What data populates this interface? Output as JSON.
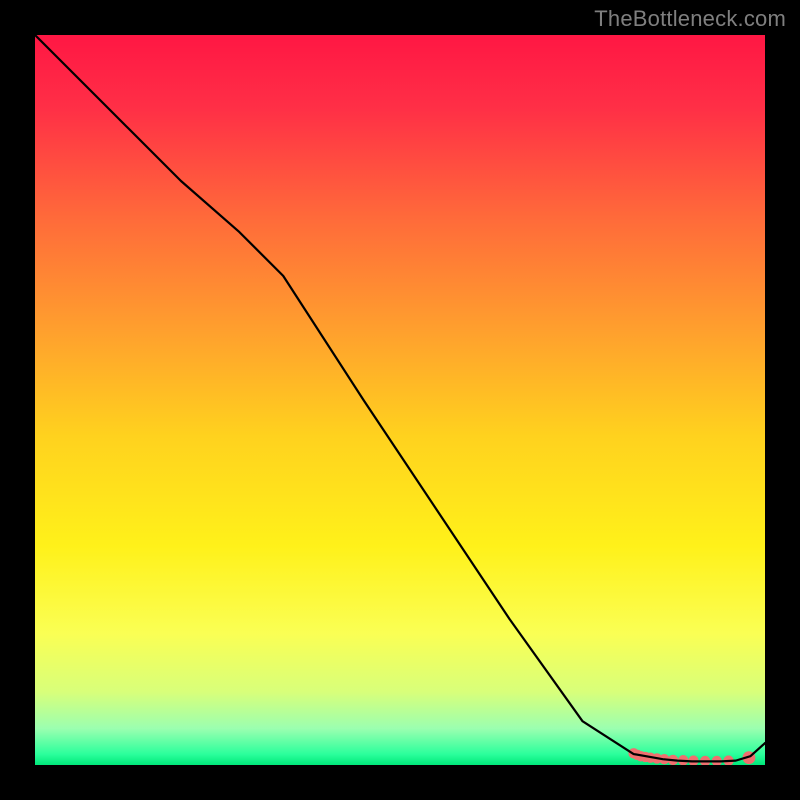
{
  "watermark": "TheBottleneck.com",
  "chart_data": {
    "type": "line",
    "title": "",
    "xlabel": "",
    "ylabel": "",
    "xlim": [
      0,
      100
    ],
    "ylim": [
      0,
      100
    ],
    "axes_visible": false,
    "background_gradient": {
      "stops": [
        {
          "offset": 0.0,
          "color": "#ff1744"
        },
        {
          "offset": 0.1,
          "color": "#ff2f46"
        },
        {
          "offset": 0.25,
          "color": "#ff6a3a"
        },
        {
          "offset": 0.4,
          "color": "#ff9e2e"
        },
        {
          "offset": 0.55,
          "color": "#ffd21e"
        },
        {
          "offset": 0.7,
          "color": "#fff11a"
        },
        {
          "offset": 0.82,
          "color": "#faff54"
        },
        {
          "offset": 0.9,
          "color": "#d8ff7a"
        },
        {
          "offset": 0.95,
          "color": "#9bffb0"
        },
        {
          "offset": 0.985,
          "color": "#2cff9c"
        },
        {
          "offset": 1.0,
          "color": "#00e87a"
        }
      ]
    },
    "series": [
      {
        "name": "bottleneck-curve",
        "stroke": "#000000",
        "stroke_width": 2.2,
        "x": [
          0,
          10,
          20,
          28,
          34,
          45,
          55,
          65,
          75,
          82,
          86,
          88,
          90,
          92,
          94,
          96,
          98,
          100
        ],
        "y": [
          100,
          90,
          80,
          73,
          67,
          50,
          35,
          20,
          6,
          1.5,
          0.8,
          0.6,
          0.5,
          0.5,
          0.5,
          0.6,
          1.2,
          3
        ]
      }
    ],
    "markers": {
      "name": "highlight-band",
      "color": "#ef6f6f",
      "radius_main": 5.2,
      "radius_end": 6.4,
      "points": [
        {
          "x": 82.0,
          "y": 1.6
        },
        {
          "x": 82.5,
          "y": 1.4
        },
        {
          "x": 83.0,
          "y": 1.2
        },
        {
          "x": 83.6,
          "y": 1.1
        },
        {
          "x": 84.3,
          "y": 1.0
        },
        {
          "x": 85.2,
          "y": 0.9
        },
        {
          "x": 86.2,
          "y": 0.8
        },
        {
          "x": 87.4,
          "y": 0.7
        },
        {
          "x": 88.8,
          "y": 0.65
        },
        {
          "x": 90.2,
          "y": 0.6
        },
        {
          "x": 91.8,
          "y": 0.55
        },
        {
          "x": 93.4,
          "y": 0.55
        },
        {
          "x": 95.0,
          "y": 0.6,
          "gapBefore": true
        },
        {
          "x": 97.8,
          "y": 1.0,
          "end": true
        }
      ]
    }
  }
}
